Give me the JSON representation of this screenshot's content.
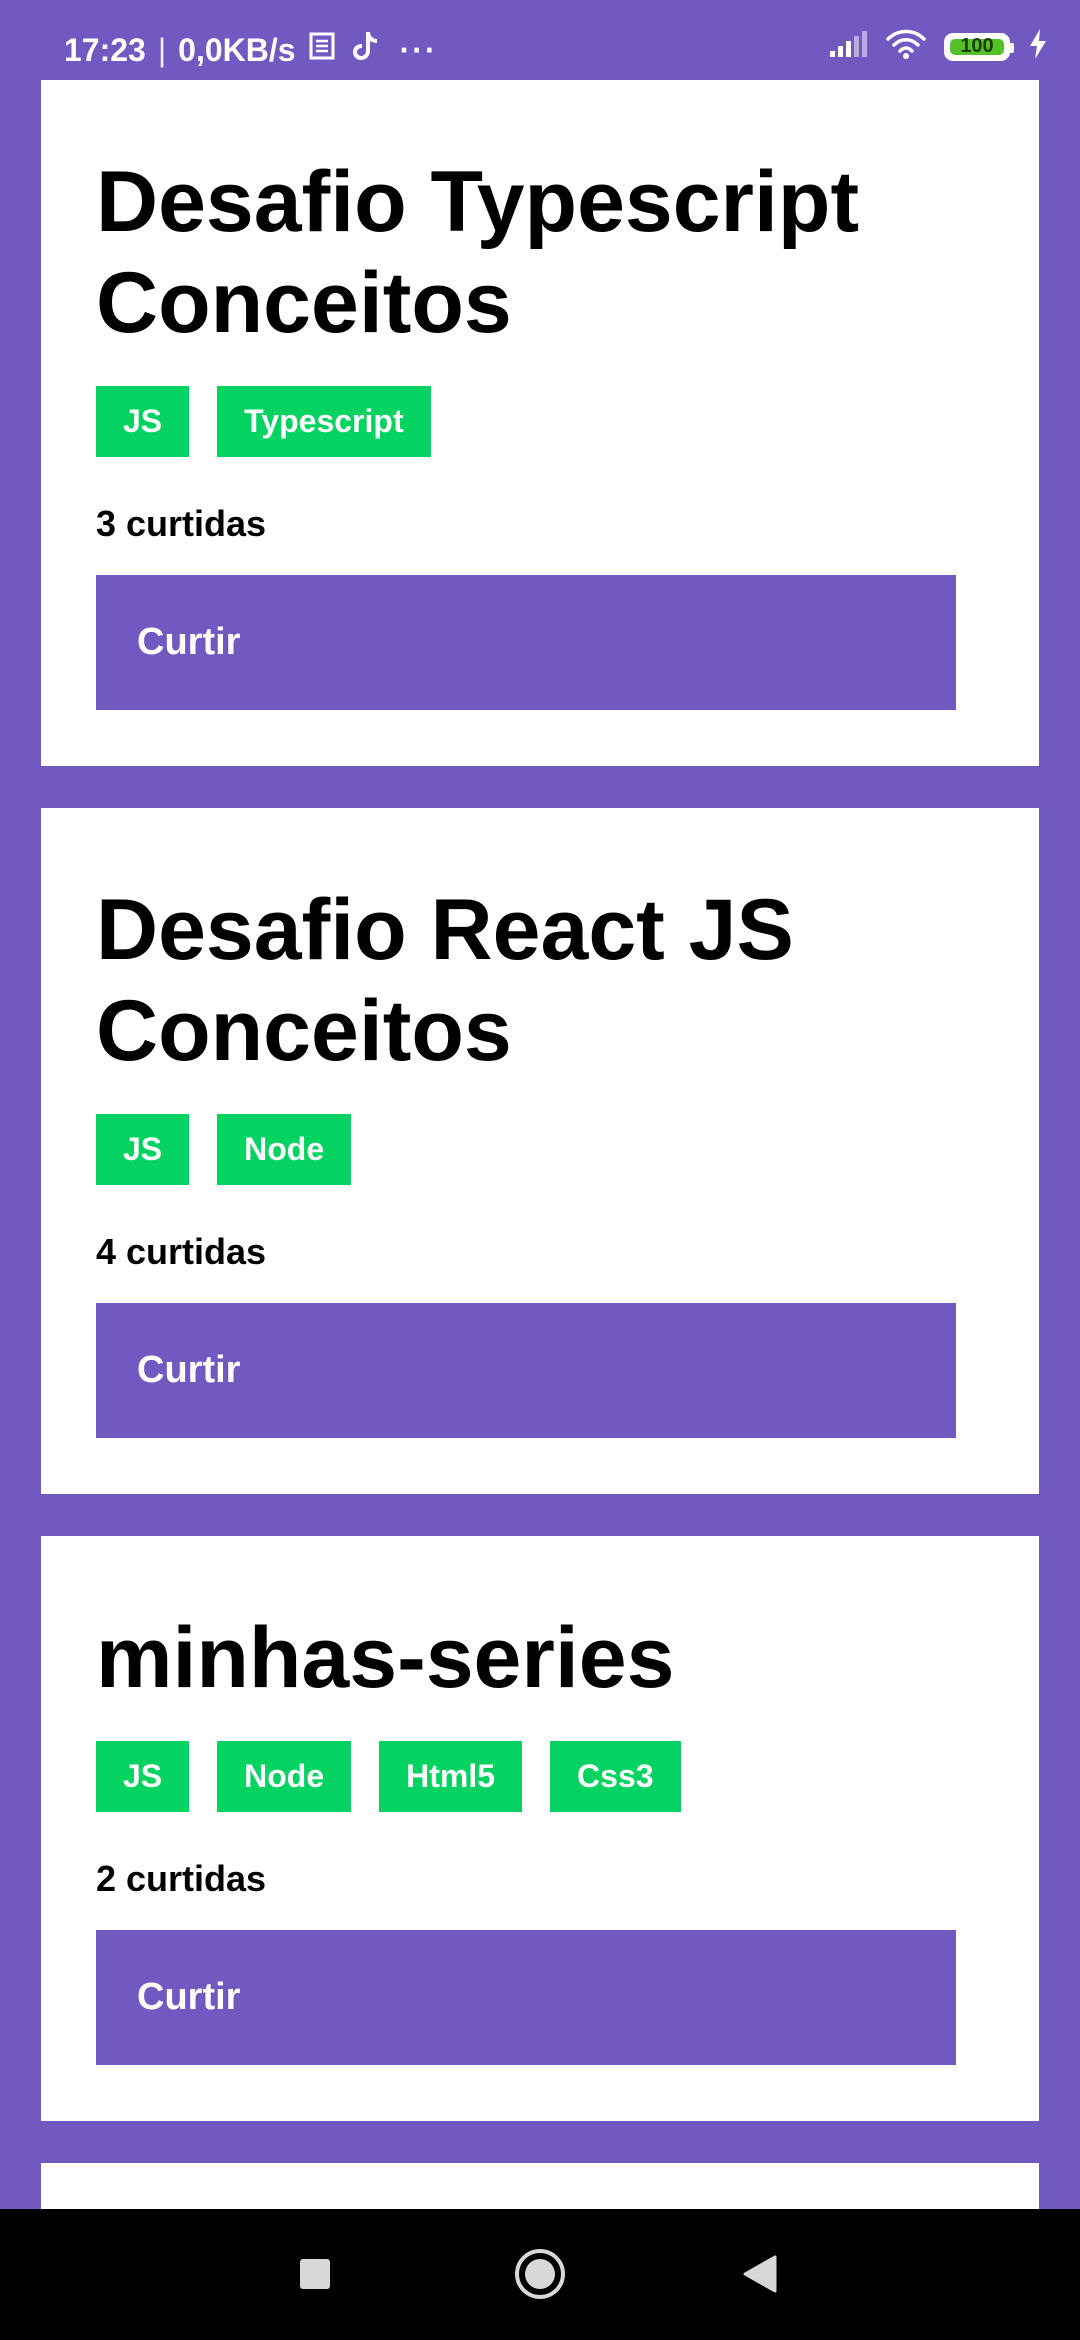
{
  "status_bar": {
    "time": "17:23",
    "separator": "|",
    "net_speed": "0,0KB/s",
    "more_glyph": "···",
    "battery": "100"
  },
  "repositories": [
    {
      "title": "Desafio Typescript Conceitos",
      "techs": [
        "JS",
        "Typescript"
      ],
      "likes_text": "3 curtidas",
      "button_label": "Curtir"
    },
    {
      "title": "Desafio React JS Conceitos",
      "techs": [
        "JS",
        "Node"
      ],
      "likes_text": "4 curtidas",
      "button_label": "Curtir"
    },
    {
      "title": "minhas-series",
      "techs": [
        "JS",
        "Node",
        "Html5",
        "Css3"
      ],
      "likes_text": "2 curtidas",
      "button_label": "Curtir"
    }
  ],
  "colors": {
    "background": "#7159c1",
    "tag": "#04d361",
    "card": "#ffffff"
  }
}
